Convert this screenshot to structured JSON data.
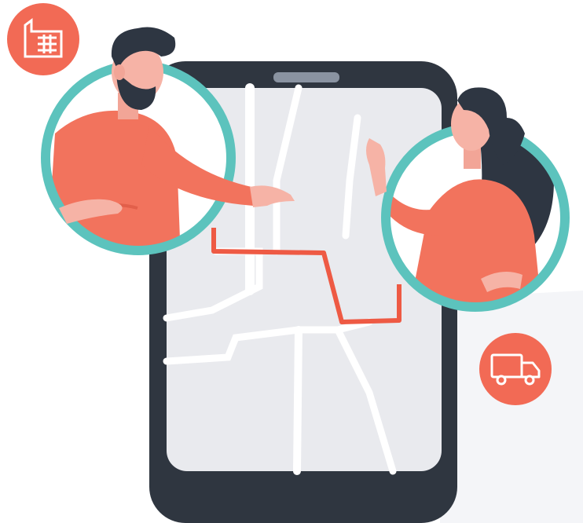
{
  "colors": {
    "background": "#ffffff",
    "tablet_frame": "#2f3640",
    "tablet_screen": "#e9eaee",
    "map_roads": "#ffffff",
    "route": "#ee5a44",
    "ring": "#5cc3bd",
    "accent_badge": "#f26a55",
    "skin": "#f6b3a6",
    "shirt": "#f2735d",
    "hair": "#2e3642"
  },
  "icons": {
    "top_left_badge": "factory-icon",
    "right_badge": "delivery-truck-icon"
  },
  "illustration": {
    "people": [
      "man-waving",
      "woman-waving"
    ]
  }
}
